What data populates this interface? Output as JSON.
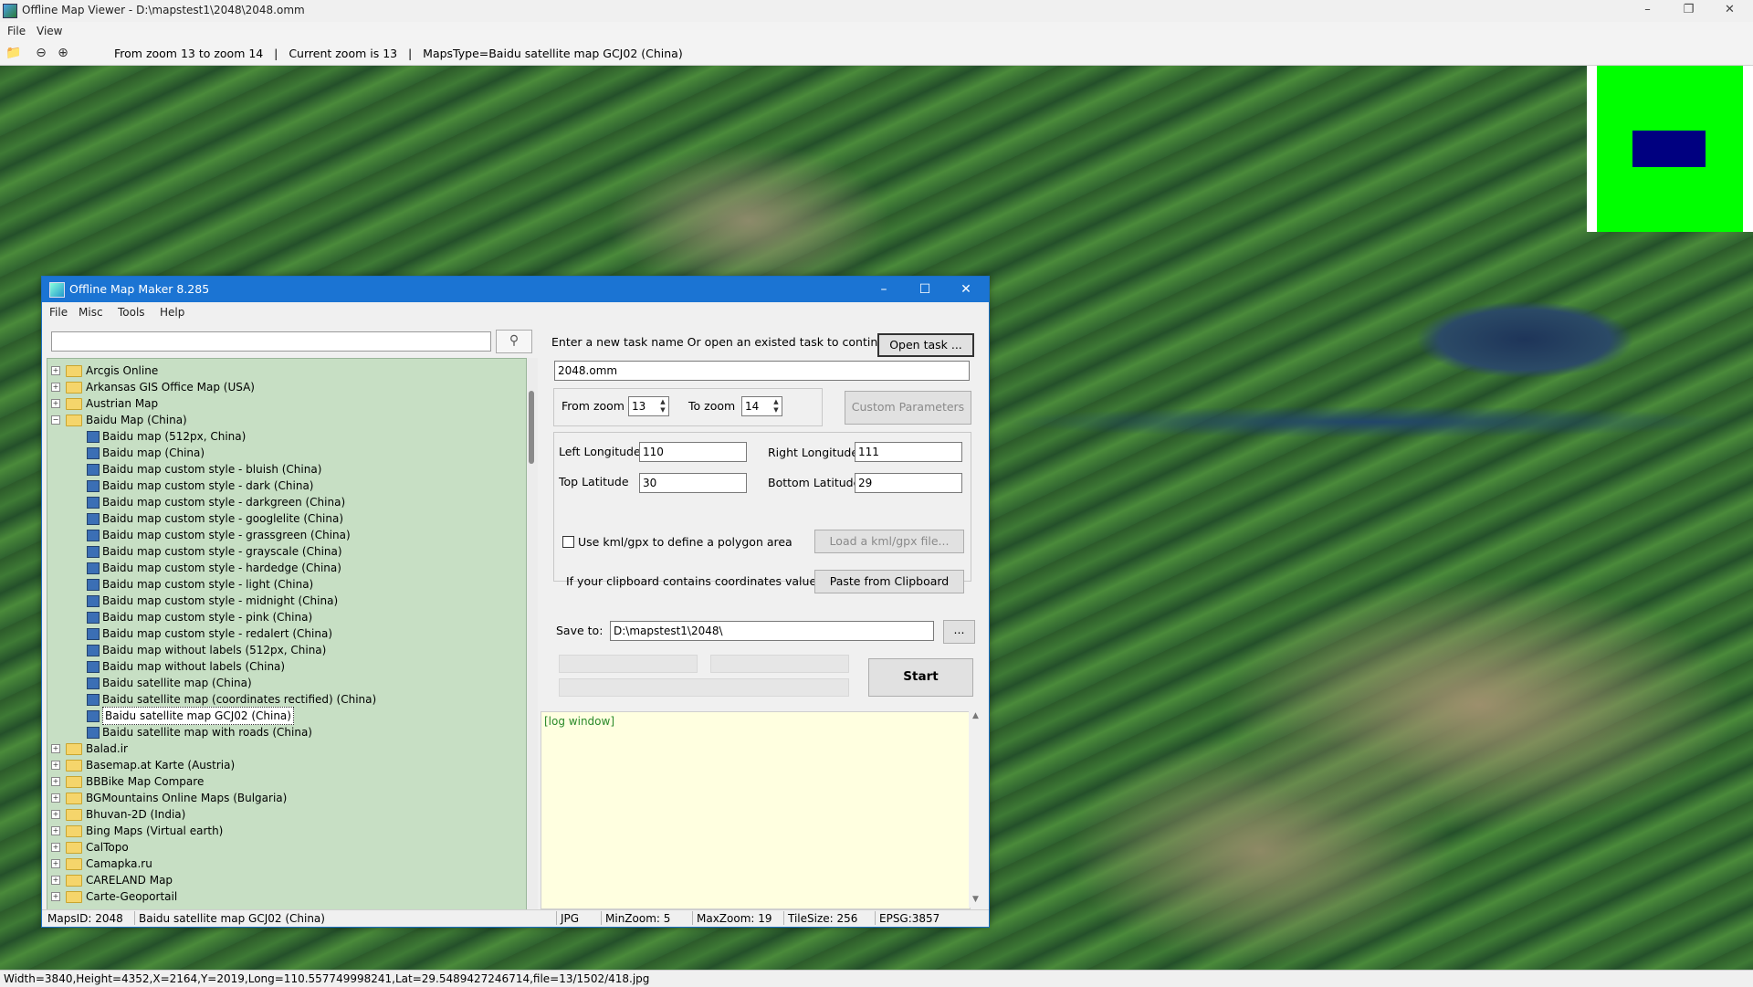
{
  "outer": {
    "title": "Offline Map Viewer - D:\\mapstest1\\2048\\2048.omm",
    "menu": [
      "File",
      "View"
    ],
    "toolbar_info": "From zoom 13 to zoom 14   |   Current zoom is 13   |   MapsType=Baidu satellite map GCJ02 (China)",
    "status": "Width=3840,Height=4352,X=2164,Y=2019,Long=110.557749998241,Lat=29.5489427246714,file=13/1502/418.jpg"
  },
  "dialog": {
    "title": "Offline Map Maker 8.285",
    "menu": [
      "File",
      "Misc",
      "Tools",
      "Help"
    ],
    "search_value": "",
    "tree": [
      {
        "label": "Arcgis Online",
        "level": 0,
        "type": "folder",
        "exp": "+"
      },
      {
        "label": "Arkansas GIS Office Map (USA)",
        "level": 0,
        "type": "folder",
        "exp": "+"
      },
      {
        "label": "Austrian Map",
        "level": 0,
        "type": "folder",
        "exp": "+"
      },
      {
        "label": "Baidu Map (China)",
        "level": 0,
        "type": "folder",
        "exp": "−"
      },
      {
        "label": "Baidu map (512px, China)",
        "level": 1,
        "type": "leaf"
      },
      {
        "label": "Baidu map (China)",
        "level": 1,
        "type": "leaf"
      },
      {
        "label": "Baidu map custom style - bluish (China)",
        "level": 1,
        "type": "leaf"
      },
      {
        "label": "Baidu map custom style - dark (China)",
        "level": 1,
        "type": "leaf"
      },
      {
        "label": "Baidu map custom style - darkgreen (China)",
        "level": 1,
        "type": "leaf"
      },
      {
        "label": "Baidu map custom style - googlelite (China)",
        "level": 1,
        "type": "leaf"
      },
      {
        "label": "Baidu map custom style - grassgreen (China)",
        "level": 1,
        "type": "leaf"
      },
      {
        "label": "Baidu map custom style - grayscale (China)",
        "level": 1,
        "type": "leaf"
      },
      {
        "label": "Baidu map custom style - hardedge (China)",
        "level": 1,
        "type": "leaf"
      },
      {
        "label": "Baidu map custom style - light (China)",
        "level": 1,
        "type": "leaf"
      },
      {
        "label": "Baidu map custom style - midnight (China)",
        "level": 1,
        "type": "leaf"
      },
      {
        "label": "Baidu map custom style - pink (China)",
        "level": 1,
        "type": "leaf"
      },
      {
        "label": "Baidu map custom style - redalert (China)",
        "level": 1,
        "type": "leaf"
      },
      {
        "label": "Baidu map without labels (512px, China)",
        "level": 1,
        "type": "leaf"
      },
      {
        "label": "Baidu map without labels (China)",
        "level": 1,
        "type": "leaf"
      },
      {
        "label": "Baidu satellite map (China)",
        "level": 1,
        "type": "leaf"
      },
      {
        "label": "Baidu satellite map (coordinates rectified) (China)",
        "level": 1,
        "type": "leaf"
      },
      {
        "label": "Baidu satellite map GCJ02 (China)",
        "level": 1,
        "type": "leaf",
        "selected": true
      },
      {
        "label": "Baidu satellite map with roads (China)",
        "level": 1,
        "type": "leaf"
      },
      {
        "label": "Balad.ir",
        "level": 0,
        "type": "folder",
        "exp": "+"
      },
      {
        "label": "Basemap.at Karte (Austria)",
        "level": 0,
        "type": "folder",
        "exp": "+"
      },
      {
        "label": "BBBike Map Compare",
        "level": 0,
        "type": "folder",
        "exp": "+"
      },
      {
        "label": "BGMountains Online Maps (Bulgaria)",
        "level": 0,
        "type": "folder",
        "exp": "+"
      },
      {
        "label": "Bhuvan-2D (India)",
        "level": 0,
        "type": "folder",
        "exp": "+"
      },
      {
        "label": "Bing Maps (Virtual earth)",
        "level": 0,
        "type": "folder",
        "exp": "+"
      },
      {
        "label": "CalTopo",
        "level": 0,
        "type": "folder",
        "exp": "+"
      },
      {
        "label": "Camapka.ru",
        "level": 0,
        "type": "folder",
        "exp": "+"
      },
      {
        "label": "CARELAND Map",
        "level": 0,
        "type": "folder",
        "exp": "+"
      },
      {
        "label": "Carte-Geoportail",
        "level": 0,
        "type": "folder",
        "exp": "+"
      }
    ],
    "task_prompt": "Enter a new task name Or open an existed task to continue:",
    "open_task": "Open task ...",
    "task_name": "2048.omm",
    "from_zoom_label": "From zoom",
    "from_zoom": "13",
    "to_zoom_label": "To zoom",
    "to_zoom": "14",
    "custom_params": "Custom Parameters",
    "left_lon_label": "Left Longitude",
    "left_lon": "110",
    "right_lon_label": "Right Longitude",
    "right_lon": "111",
    "top_lat_label": "Top Latitude",
    "top_lat": "30",
    "bottom_lat_label": "Bottom Latitude",
    "bottom_lat": "29",
    "kml_check_label": "Use kml/gpx to define a polygon area",
    "kml_button": "Load a kml/gpx file...",
    "clipboard_label": "If your clipboard contains coordinates values:",
    "clipboard_button": "Paste from Clipboard",
    "save_to_label": "Save to:",
    "save_to": "D:\\mapstest1\\2048\\",
    "browse": "...",
    "start": "Start",
    "log": "[log window]",
    "status": {
      "maps_id": "MapsID: 2048",
      "map_name": "Baidu satellite map GCJ02 (China)",
      "format": "JPG",
      "min_zoom": "MinZoom: 5",
      "max_zoom": "MaxZoom: 19",
      "tile_size": "TileSize: 256",
      "epsg": "EPSG:3857"
    }
  }
}
